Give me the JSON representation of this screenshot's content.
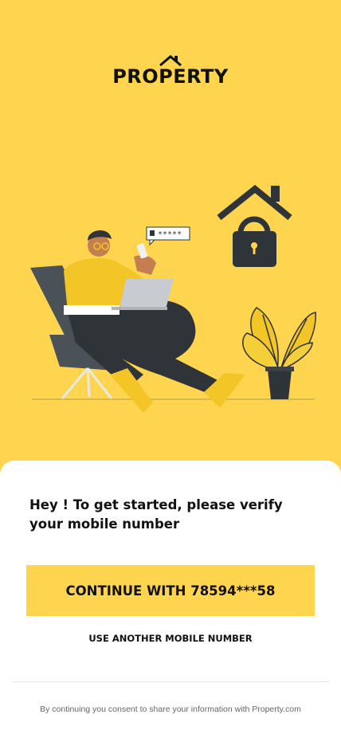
{
  "brand": {
    "name": "PROPERTY",
    "icon": "house-roof-icon"
  },
  "illustration": {
    "description_icon": "person-with-phone-security-icon",
    "pin_mask": "*****"
  },
  "verify": {
    "heading": "Hey ! To get started, please verify your mobile number",
    "continue_label": "CONTINUE WITH 78594***58",
    "another_label": "USE ANOTHER MOBILE NUMBER",
    "consent": "By continuing you consent to share your information with Property.com"
  },
  "colors": {
    "accent": "#ffd54f",
    "dark": "#2f3438",
    "text": "#111111"
  }
}
